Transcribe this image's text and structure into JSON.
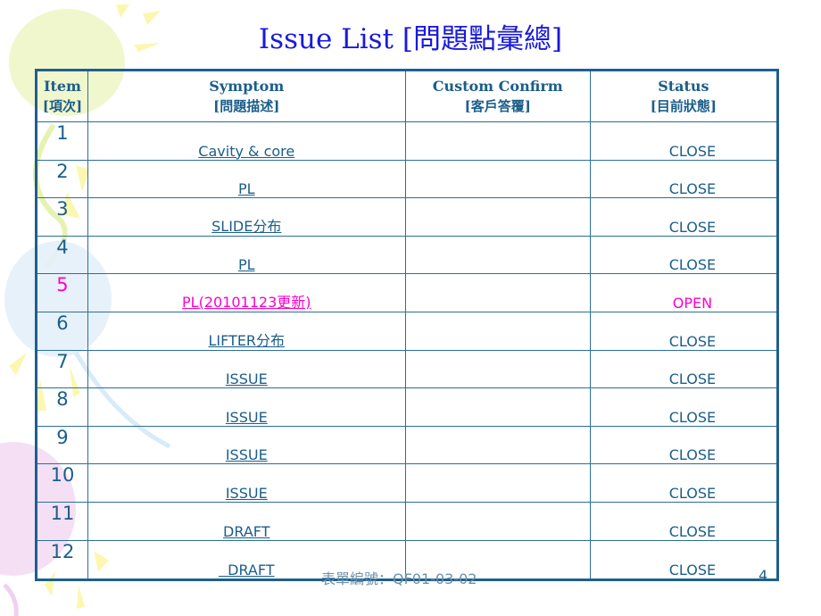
{
  "title": "Issue List [問題點彙總]",
  "table": {
    "headers": [
      {
        "label": "Item",
        "sub": "[項次]"
      },
      {
        "label": "Symptom",
        "sub": "[問題描述]"
      },
      {
        "label": "Custom Confirm",
        "sub": "[客戶答覆]"
      },
      {
        "label": "Status",
        "sub": "[目前狀態]"
      }
    ],
    "rows": [
      {
        "item": "1",
        "symptom": "Cavity & core",
        "confirm": "",
        "status": "CLOSE"
      },
      {
        "item": "2",
        "symptom": "PL",
        "confirm": "",
        "status": "CLOSE"
      },
      {
        "item": "3",
        "symptom": "SLIDE分布",
        "confirm": "",
        "status": "CLOSE"
      },
      {
        "item": "4",
        "symptom": "PL",
        "confirm": "",
        "status": "CLOSE"
      },
      {
        "item": "5",
        "symptom": "PL(20101123更新)",
        "confirm": "",
        "status": "OPEN"
      },
      {
        "item": "6",
        "symptom": "LIFTER分布",
        "confirm": "",
        "status": "CLOSE"
      },
      {
        "item": "7",
        "symptom": "ISSUE",
        "confirm": "",
        "status": "CLOSE"
      },
      {
        "item": "8",
        "symptom": "ISSUE",
        "confirm": "",
        "status": "CLOSE"
      },
      {
        "item": "9",
        "symptom": "ISSUE",
        "confirm": "",
        "status": "CLOSE"
      },
      {
        "item": "10",
        "symptom": "ISSUE",
        "confirm": "",
        "status": "CLOSE"
      },
      {
        "item": "11",
        "symptom": "DRAFT",
        "confirm": "",
        "status": "CLOSE"
      },
      {
        "item": "12",
        "symptom": "  DRAFT",
        "confirm": "",
        "status": "CLOSE"
      }
    ]
  },
  "footer": {
    "form_code": "表單編號：QF01-03-02",
    "page_number": "4"
  },
  "colors": {
    "title": "#1a1adb",
    "table_text": "#1b5e8a",
    "border": "#1f5f8f",
    "open_highlight": "#ff00cc"
  }
}
